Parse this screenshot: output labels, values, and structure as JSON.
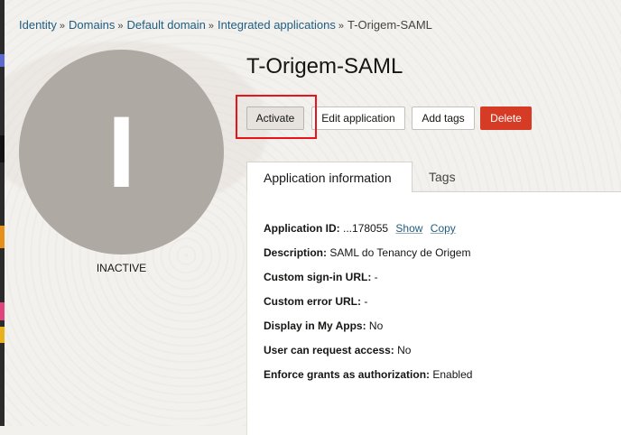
{
  "breadcrumb": {
    "items": [
      "Identity",
      "Domains",
      "Default domain",
      "Integrated applications"
    ],
    "current": "T-Origem-SAML",
    "separator": "»"
  },
  "avatar": {
    "letter": "I",
    "status": "INACTIVE"
  },
  "app": {
    "title": "T-Origem-SAML"
  },
  "actions": {
    "activate": "Activate",
    "edit": "Edit application",
    "add_tags": "Add tags",
    "delete": "Delete"
  },
  "tabs": {
    "info": "Application information",
    "tags": "Tags"
  },
  "info": {
    "app_id_label": "Application ID:",
    "app_id_value": "...178055",
    "show_link": "Show",
    "copy_link": "Copy",
    "description_label": "Description:",
    "description_value": "SAML do Tenancy de Origem",
    "signin_label": "Custom sign-in URL:",
    "signin_value": "-",
    "error_label": "Custom error URL:",
    "error_value": "-",
    "myapps_label": "Display in My Apps:",
    "myapps_value": "No",
    "request_label": "User can request access:",
    "request_value": "No",
    "grants_label": "Enforce grants as authorization:",
    "grants_value": "Enabled"
  },
  "colors": {
    "accent_link": "#1f5d80",
    "delete": "#d63b25",
    "highlight": "#e8131b",
    "avatar": "#aea9a3"
  }
}
